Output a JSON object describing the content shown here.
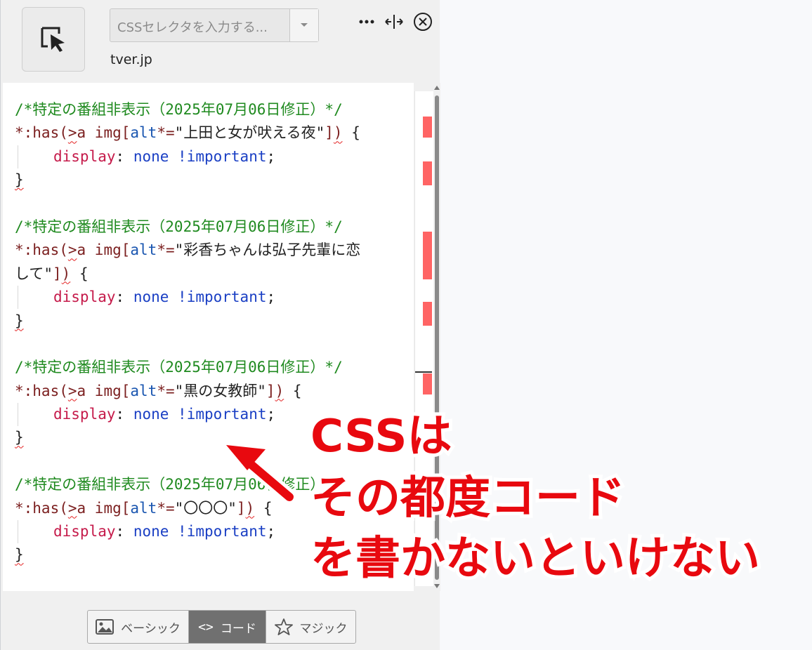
{
  "selector": {
    "placeholder": "CSSセレクタを入力する..."
  },
  "domain": "tver.jp",
  "code_lines": [
    [
      "cm:/*特定の番組非表示（2025年07月06日修正）*/"
    ],
    [
      "kw:*:has(",
      "sqkw:>",
      "kw:a img[",
      "attr:alt",
      "kw:*=",
      "str:\"上田と女が吠える夜\"",
      "kw:]",
      "sqkw:)",
      "str: {"
    ],
    [
      "indent:",
      "prop:display",
      "str:: ",
      "val:none",
      "str: ",
      "imp:!important",
      "str:;"
    ],
    [
      "sqstr:}"
    ],
    [
      "str:"
    ],
    [
      "cm:/*特定の番組非表示（2025年07月06日修正）*/"
    ],
    [
      "kw:*:has(",
      "sqkw:>",
      "kw:a img[",
      "attr:alt",
      "kw:*=",
      "str:\"彩香ちゃんは弘子先輩に恋"
    ],
    [
      "str:して\"",
      "kw:]",
      "sqkw:)",
      "str: {"
    ],
    [
      "indent:",
      "prop:display",
      "str:: ",
      "val:none",
      "str: ",
      "imp:!important",
      "str:;"
    ],
    [
      "sqstr:}"
    ],
    [
      "str:"
    ],
    [
      "cm:/*特定の番組非表示（2025年07月06日修正）*/"
    ],
    [
      "kw:*:has(",
      "sqkw:>",
      "kw:a img[",
      "attr:alt",
      "kw:*=",
      "str:\"黒の女教師\"",
      "kw:]",
      "sqkw:)",
      "str: {"
    ],
    [
      "indent:",
      "prop:display",
      "str:: ",
      "val:none",
      "str: ",
      "imp:!important",
      "str:;"
    ],
    [
      "sqstr:}"
    ],
    [
      "str:"
    ],
    [
      "cm:/*特定の番組非表示（2025年07月06日修正）*/"
    ],
    [
      "kw:*:has(",
      "sqkw:>",
      "kw:a img[",
      "attr:alt",
      "kw:*=",
      "str:\"〇〇〇\"",
      "kw:]",
      "sqkw:)",
      "str: {"
    ],
    [
      "indent:",
      "prop:display",
      "str:: ",
      "val:none",
      "str: ",
      "imp:!important",
      "str:;"
    ],
    [
      "sqstr:}"
    ]
  ],
  "modes": [
    {
      "label": "ベーシック",
      "icon": "image-icon",
      "active": false
    },
    {
      "label": "コード",
      "icon": "code-icon",
      "active": true
    },
    {
      "label": "マジック",
      "icon": "star-icon",
      "active": false
    }
  ],
  "annotation": {
    "line1": "CSSは",
    "line2": "その都度コード",
    "line3": "を書かないといけない"
  },
  "colors": {
    "accent": "#e8090f",
    "marker": "#ff6464",
    "comment": "#1f8a1f",
    "property": "#c51a4a",
    "value": "#1a3fc4"
  }
}
